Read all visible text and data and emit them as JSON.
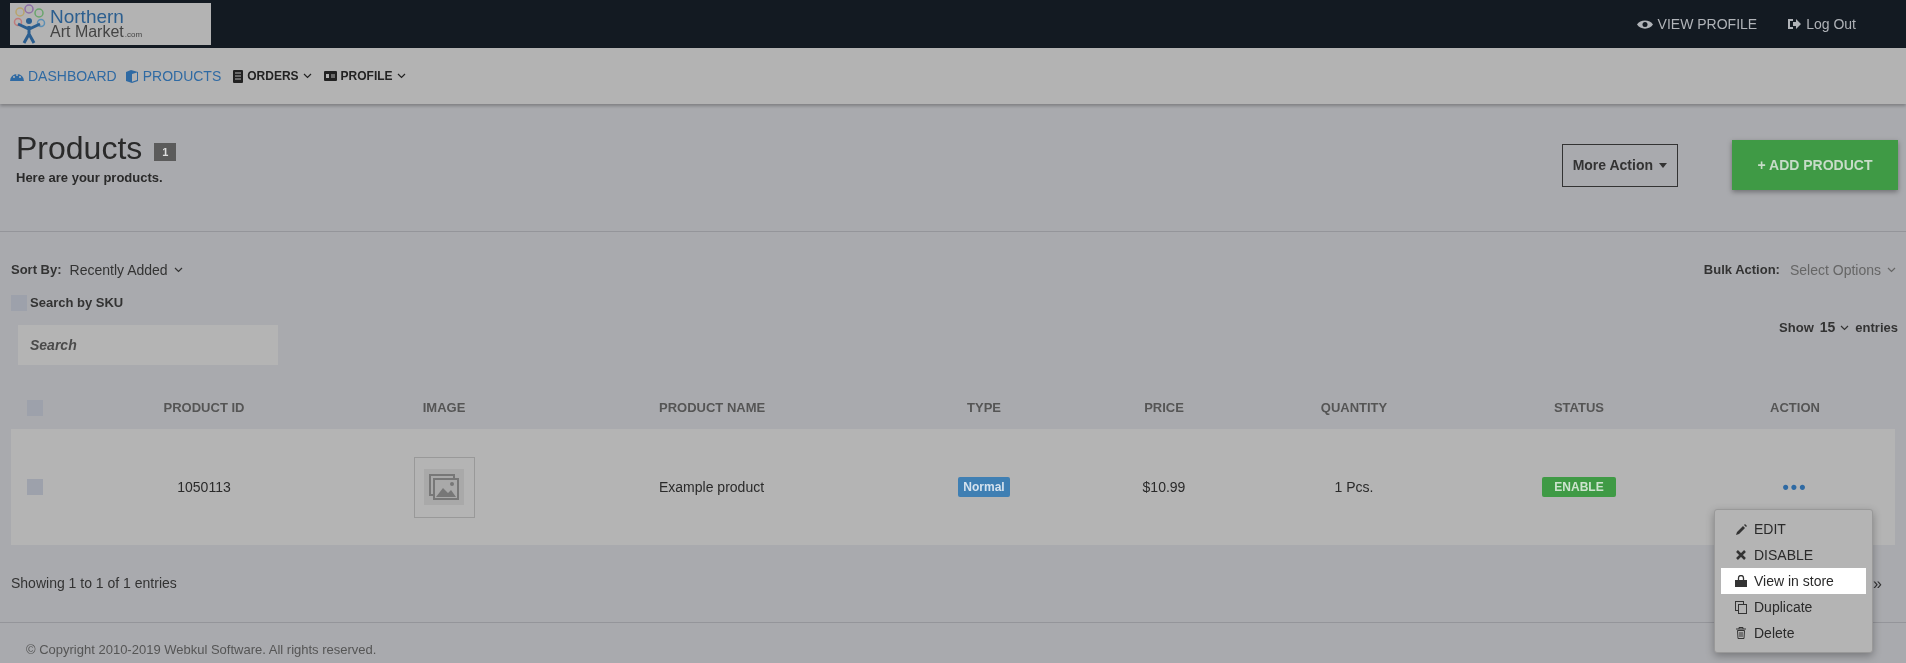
{
  "logo": {
    "line1": "Northern",
    "line2": "Art Market",
    "suffix": ".com"
  },
  "top_links": [
    {
      "label": "VIEW PROFILE"
    },
    {
      "label": "Log Out"
    }
  ],
  "nav": [
    {
      "label": "DASHBOARD",
      "kind": "link"
    },
    {
      "label": "PRODUCTS",
      "kind": "link"
    },
    {
      "label": "ORDERS",
      "kind": "dropdown"
    },
    {
      "label": "PROFILE",
      "kind": "dropdown"
    }
  ],
  "page": {
    "title": "Products",
    "count": "1",
    "subtitle": "Here are your products.",
    "more_action": "More Action",
    "add_product": "+ ADD PRODUCT"
  },
  "sort": {
    "label": "Sort By:",
    "value": "Recently Added"
  },
  "bulk": {
    "label": "Bulk Action:",
    "value": "Select Options"
  },
  "search_by_sku": {
    "label": "Search by SKU",
    "checked": false
  },
  "search": {
    "placeholder": "Search"
  },
  "show": {
    "label": "Show",
    "value": "15",
    "suffix": "entries"
  },
  "table": {
    "select_all": {
      "checked": false
    },
    "columns": [
      "PRODUCT ID",
      "IMAGE",
      "PRODUCT NAME",
      "TYPE",
      "PRICE",
      "QUANTITY",
      "STATUS",
      "ACTION"
    ],
    "rows": [
      {
        "checked": false,
        "id": "1050113",
        "name": "Example product",
        "type": "Normal",
        "price": "$10.99",
        "quantity": "1 Pcs.",
        "status": "ENABLE",
        "action": "•••"
      }
    ]
  },
  "action_menu": [
    {
      "label": "EDIT",
      "selected": false
    },
    {
      "label": "DISABLE",
      "selected": false
    },
    {
      "label": "View in store",
      "selected": true
    },
    {
      "label": "Duplicate",
      "selected": false
    },
    {
      "label": "Delete",
      "selected": false
    }
  ],
  "info": "Showing 1 to 1 of 1 entries",
  "pager": "»",
  "footer": "© Copyright 2010-2019 Webkul Software. All rights reserved."
}
